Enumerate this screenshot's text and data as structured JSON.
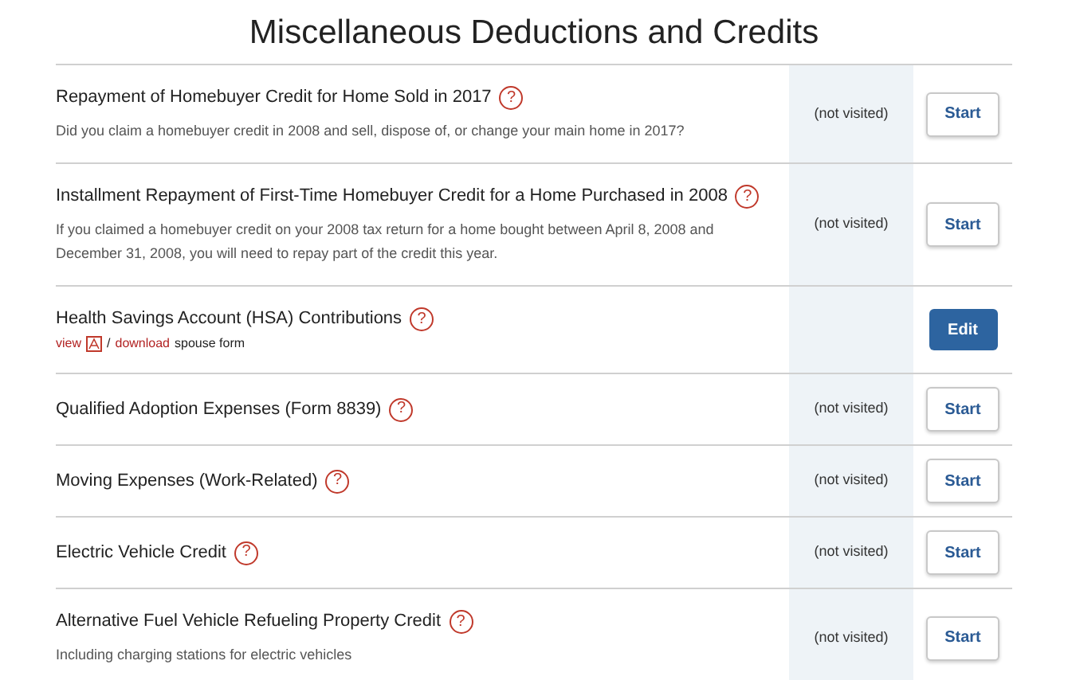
{
  "title": "Miscellaneous Deductions and Credits",
  "items": [
    {
      "title": "Repayment of Homebuyer Credit for Home Sold in 2017",
      "help": "?",
      "description": "Did you claim a homebuyer credit in 2008 and sell, dispose of, or change your main home in 2017?",
      "status": "(not visited)",
      "button": {
        "label": "Start",
        "primary": false
      }
    },
    {
      "title": "Installment Repayment of First-Time Homebuyer Credit for a Home Purchased in 2008",
      "help": "?",
      "description": "If you claimed a homebuyer credit on your 2008 tax return for a home bought between April 8, 2008 and December 31, 2008, you will need to repay part of the credit this year.",
      "status": "(not visited)",
      "button": {
        "label": "Start",
        "primary": false
      }
    },
    {
      "title": "Health Savings Account (HSA) Contributions",
      "help": "?",
      "links": {
        "view": "view",
        "separator": "/",
        "download": "download",
        "suffix": "spouse form"
      },
      "button": {
        "label": "Edit",
        "primary": true
      }
    },
    {
      "title": "Qualified Adoption Expenses (Form 8839)",
      "help": "?",
      "status": "(not visited)",
      "button": {
        "label": "Start",
        "primary": false
      }
    },
    {
      "title": "Moving Expenses (Work-Related)",
      "help": "?",
      "status": "(not visited)",
      "button": {
        "label": "Start",
        "primary": false
      }
    },
    {
      "title": "Electric Vehicle Credit",
      "help": "?",
      "status": "(not visited)",
      "button": {
        "label": "Start",
        "primary": false
      }
    },
    {
      "title": "Alternative Fuel Vehicle Refueling Property Credit",
      "help": "?",
      "description": "Including charging stations for electric vehicles",
      "status": "(not visited)",
      "button": {
        "label": "Start",
        "primary": false
      }
    }
  ]
}
